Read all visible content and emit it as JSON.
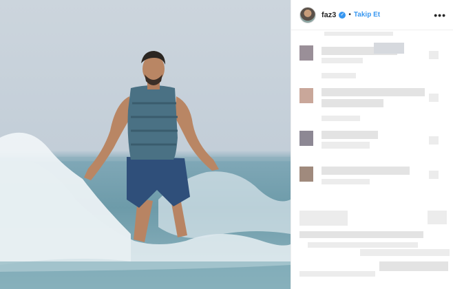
{
  "post": {
    "username": "faz3",
    "verified_icon": "verified-badge-icon",
    "separator": "•",
    "follow_label": "Takip Et",
    "more_icon": "more-options-icon",
    "more_glyph": "•••"
  },
  "comments": {
    "state": "pixelated"
  },
  "colors": {
    "accent": "#3897f0",
    "text": "#262626",
    "sky": "#c8d2db",
    "sea": "#6f9dab"
  }
}
